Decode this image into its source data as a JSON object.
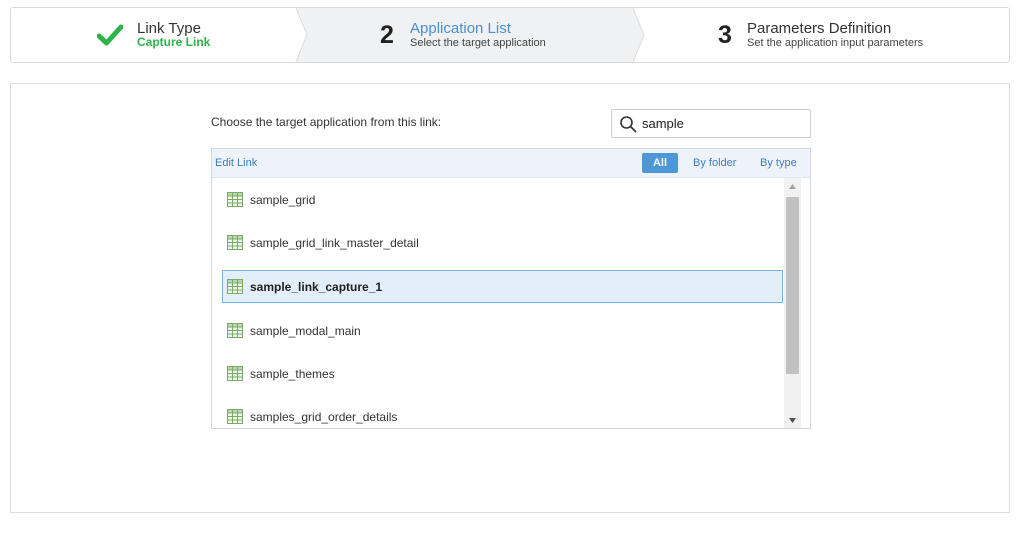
{
  "wizard": {
    "steps": [
      {
        "number": "",
        "title": "Link Type",
        "subtitle": "Capture Link",
        "icon": "checkmark-icon",
        "status": "completed"
      },
      {
        "number": "2",
        "title": "Application List",
        "subtitle": "Select the target application",
        "status": "active"
      },
      {
        "number": "3",
        "title": "Parameters Definition",
        "subtitle": "Set the application input parameters",
        "status": "pending"
      }
    ]
  },
  "main": {
    "instruction": "Choose the target application from this link:",
    "search": {
      "value": "sample",
      "icon": "search-icon"
    },
    "list_header": {
      "edit_link": "Edit Link",
      "filters": {
        "all": "All",
        "by_folder": "By folder",
        "by_type": "By type"
      },
      "active_filter": "all"
    },
    "items": [
      {
        "label": "sample_grid",
        "icon": "grid-icon"
      },
      {
        "label": "sample_grid_link_master_detail",
        "icon": "grid-icon"
      },
      {
        "label": "sample_link_capture_1",
        "icon": "grid-icon",
        "selected": true
      },
      {
        "label": "sample_modal_main",
        "icon": "grid-icon"
      },
      {
        "label": "sample_themes",
        "icon": "grid-icon"
      },
      {
        "label": "samples_grid_order_details",
        "icon": "grid-icon"
      }
    ]
  },
  "colors": {
    "accent": "#4a8fd0",
    "success": "#2eb24a",
    "filter_active_bg": "#4d97d6",
    "selected_row_bg": "#e2effb",
    "selected_row_border": "#7eb1e0"
  }
}
